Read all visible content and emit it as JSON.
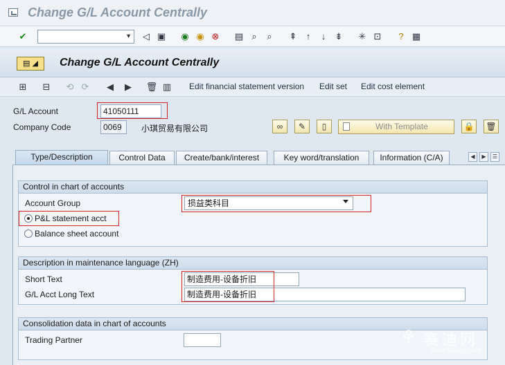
{
  "window": {
    "title": "Change G/L Account Centrally"
  },
  "screen": {
    "title": "Change G/L Account Centrally"
  },
  "app_toolbar": {
    "edit_fs_version": "Edit financial statement version",
    "edit_set": "Edit set",
    "edit_cost_element": "Edit cost element"
  },
  "header": {
    "gl_account_label": "G/L Account",
    "gl_account_value": "41050111",
    "company_code_label": "Company Code",
    "company_code_value": "0069",
    "company_name": "小琪贸易有限公司",
    "with_template_label": "With Template"
  },
  "tabs": [
    {
      "label": "Type/Description",
      "active": true
    },
    {
      "label": "Control Data",
      "active": false
    },
    {
      "label": "Create/bank/interest",
      "active": false
    },
    {
      "label": "Key word/translation",
      "active": false
    },
    {
      "label": "Information (C/A)",
      "active": false
    }
  ],
  "control_group": {
    "title": "Control in chart of accounts",
    "account_group_label": "Account Group",
    "account_group_value": "损益类科目",
    "pl_label": "P&L statement acct",
    "bs_label": "Balance sheet account",
    "selected": "pl"
  },
  "description_group": {
    "title": "Description in maintenance language (ZH)",
    "short_text_label": "Short Text",
    "short_text_value": "制造费用-设备折旧",
    "long_text_label": "G/L Acct Long Text",
    "long_text_value": "制造费用-设备折旧"
  },
  "consolidation_group": {
    "title": "Consolidation data in chart of accounts",
    "trading_partner_label": "Trading Partner",
    "trading_partner_value": ""
  },
  "watermark": {
    "cn": "赛迪网",
    "url": "www.91sap.com"
  },
  "colors": {
    "highlight_red": "#d62222",
    "tab_active": "#c5d8ec",
    "header_bg": "#d5e0ec"
  }
}
